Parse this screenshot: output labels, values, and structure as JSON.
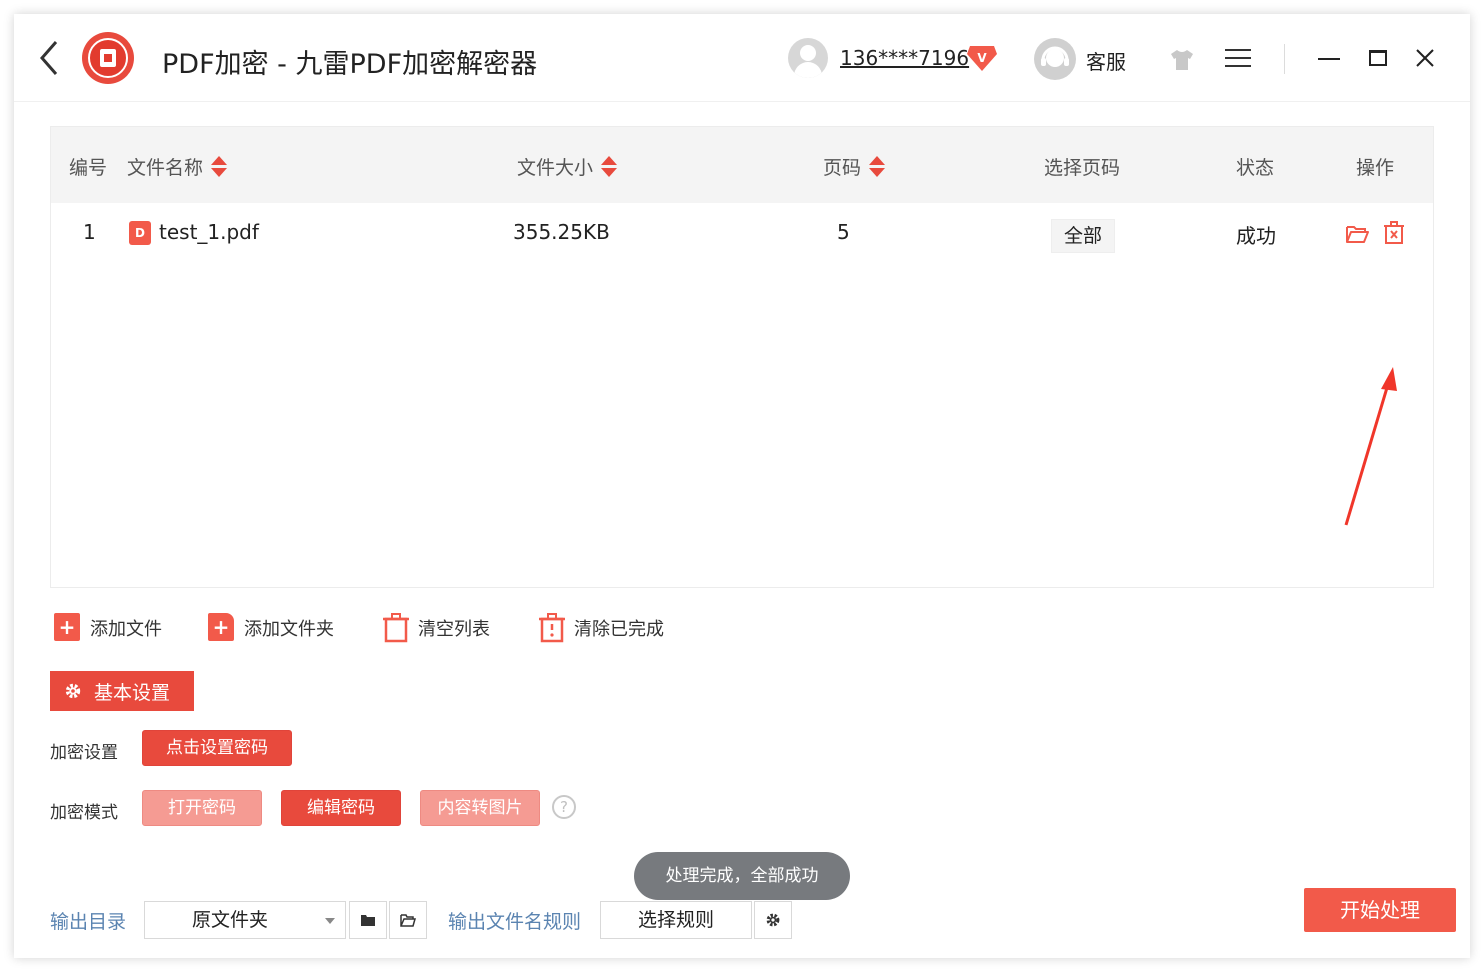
{
  "header": {
    "title": "PDF加密 - 九雷PDF加密解密器",
    "user_phone": "136****7196",
    "vip_badge": "V",
    "service_label": "客服",
    "brand_color": "#e84a3d"
  },
  "table": {
    "columns": [
      "编号",
      "文件名称",
      "文件大小",
      "页码",
      "选择页码",
      "状态",
      "操作"
    ],
    "rows": [
      {
        "index": "1",
        "file_icon": "D",
        "name": "test_1.pdf",
        "size": "355.25KB",
        "pages": "5",
        "page_select": "全部",
        "status": "成功"
      }
    ]
  },
  "toolbar": {
    "add_file": "添加文件",
    "add_folder": "添加文件夹",
    "clear_list": "清空列表",
    "clear_done": "清除已完成"
  },
  "settings": {
    "tab_label": "基本设置",
    "encrypt_setting_label": "加密设置",
    "set_password_button": "点击设置密码",
    "encrypt_mode_label": "加密模式",
    "modes": [
      "打开密码",
      "编辑密码",
      "内容转图片"
    ],
    "selected_mode": "编辑密码",
    "help": "?"
  },
  "toast": "处理完成，全部成功",
  "bottom": {
    "output_dir_label": "输出目录",
    "output_dir_value": "原文件夹",
    "output_name_rule_label": "输出文件名规则",
    "select_rule_button": "选择规则",
    "start_button": "开始处理"
  }
}
